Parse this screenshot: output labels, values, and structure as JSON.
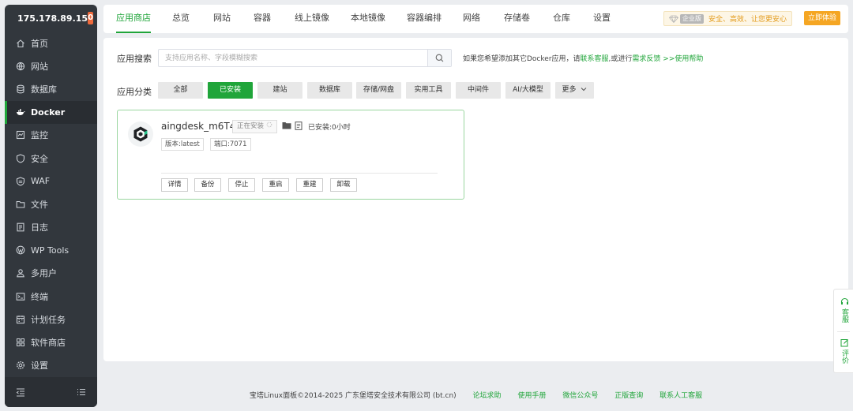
{
  "sidebar": {
    "ip": "175.178.89.15",
    "badge": "0",
    "items": [
      {
        "label": "首页",
        "icon": "home-icon"
      },
      {
        "label": "网站",
        "icon": "globe-icon"
      },
      {
        "label": "数据库",
        "icon": "database-icon"
      },
      {
        "label": "Docker",
        "icon": "docker-icon"
      },
      {
        "label": "监控",
        "icon": "monitor-icon"
      },
      {
        "label": "安全",
        "icon": "shield-icon"
      },
      {
        "label": "WAF",
        "icon": "waf-shield-icon"
      },
      {
        "label": "文件",
        "icon": "folder-icon"
      },
      {
        "label": "日志",
        "icon": "log-icon"
      },
      {
        "label": "WP Tools",
        "icon": "wordpress-icon"
      },
      {
        "label": "多用户",
        "icon": "users-icon"
      },
      {
        "label": "终端",
        "icon": "terminal-icon"
      },
      {
        "label": "计划任务",
        "icon": "calendar-icon"
      },
      {
        "label": "软件商店",
        "icon": "grid-icon"
      },
      {
        "label": "设置",
        "icon": "gear-icon"
      }
    ]
  },
  "tabs": [
    "应用商店",
    "总览",
    "网站",
    "容器",
    "线上镜像",
    "本地镜像",
    "容器编排",
    "网络",
    "存储卷",
    "仓库",
    "设置"
  ],
  "enterprise": {
    "tag": "企业版",
    "slogan": "安全、高效、让您更安心",
    "button": "立即体验"
  },
  "search": {
    "label": "应用搜索",
    "placeholder": "支持应用名称、字段模糊搜索",
    "hint_prefix": "如果您希望添加其它Docker应用，请",
    "hint_link1": "联系客服",
    "hint_mid": ",或进行",
    "hint_link2": "需求反馈",
    "hint_link3": ">>使用帮助"
  },
  "categories": {
    "label": "应用分类",
    "items": [
      "全部",
      "已安装",
      "建站",
      "数据库",
      "存储/网盘",
      "实用工具",
      "中间件",
      "AI/大模型",
      "更多"
    ]
  },
  "app": {
    "name": "aingdesk_m6T4",
    "status": "正在安装",
    "installed_time": "已安装:0小时",
    "version": "版本:latest",
    "port": "端口:7071",
    "actions": [
      "详情",
      "备份",
      "停止",
      "重启",
      "重建",
      "卸载"
    ]
  },
  "footer": {
    "copyright": "宝塔Linux面板©2014-2025 广东堡塔安全技术有限公司 (bt.cn)",
    "links": [
      "论坛求助",
      "使用手册",
      "微信公众号",
      "正版查询",
      "联系人工客服"
    ]
  },
  "float": {
    "service": "客服",
    "review": "评价"
  }
}
